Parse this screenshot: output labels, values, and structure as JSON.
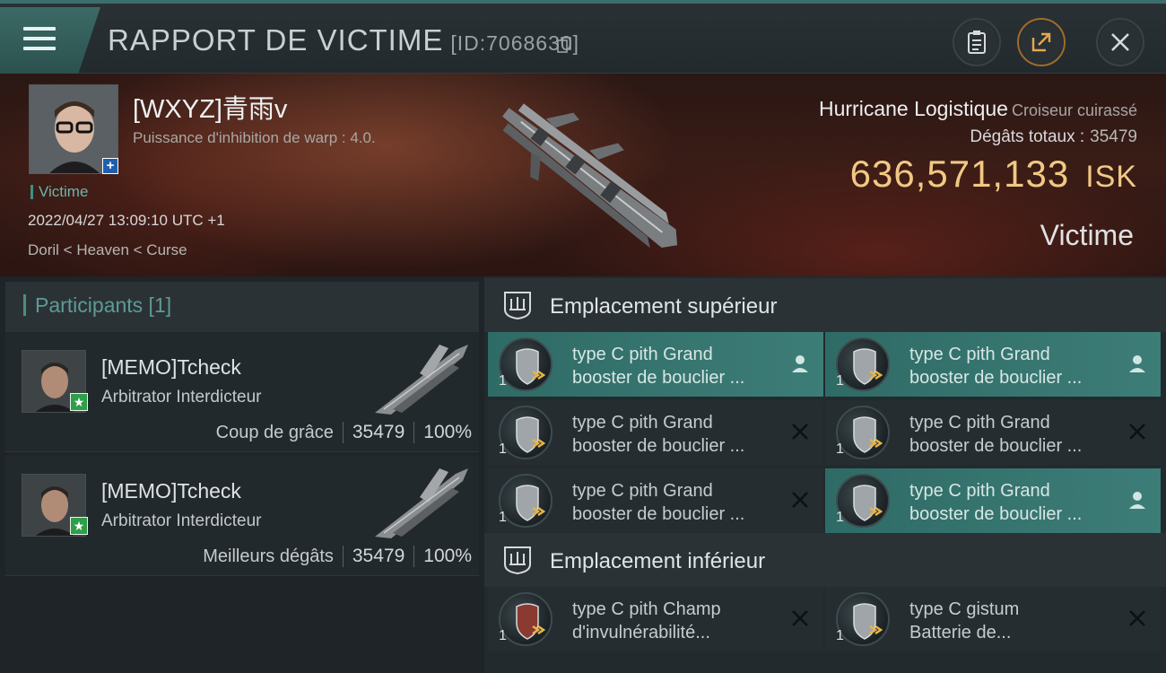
{
  "header": {
    "title": "RAPPORT DE VICTIME",
    "report_id": "[ID:7068630]"
  },
  "victim": {
    "name": "[WXYZ]青雨v",
    "subtitle": "Puissance d'inhibition de warp : 4.0.",
    "role_tag": "Victime",
    "datetime": "2022/04/27 13:09:10 UTC +1",
    "location": "Doril < Heaven < Curse",
    "ship_name": "Hurricane Logistique",
    "ship_class": "Croiseur cuirassé",
    "damage_label": "Dégâts totaux :",
    "damage_value": "35479",
    "isk_value": "636,571,133",
    "isk_unit": "ISK",
    "status_label": "Victime"
  },
  "participants": {
    "title": "Participants [1]",
    "rows": [
      {
        "name": "[MEMO]Tcheck",
        "ship": "Arbitrator Interdicteur",
        "label": "Coup de grâce",
        "damage": "35479",
        "percent": "100%"
      },
      {
        "name": "[MEMO]Tcheck",
        "ship": "Arbitrator Interdicteur",
        "label": "Meilleurs dégâts",
        "damage": "35479",
        "percent": "100%"
      }
    ]
  },
  "fittings": {
    "high_slots_title": "Emplacement supérieur",
    "low_slots_title": "Emplacement inférieur",
    "high_slots": [
      {
        "qty": "1",
        "line1": "type C pith Grand",
        "line2": "booster de bouclier ...",
        "status": "person-icon",
        "active": true
      },
      {
        "qty": "1",
        "line1": "type C pith Grand",
        "line2": "booster de bouclier ...",
        "status": "person-icon",
        "active": true
      },
      {
        "qty": "1",
        "line1": "type C pith Grand",
        "line2": "booster de bouclier ...",
        "status": "destroyed-x-icon",
        "active": false
      },
      {
        "qty": "1",
        "line1": "type C pith Grand",
        "line2": "booster de bouclier ...",
        "status": "destroyed-x-icon",
        "active": false
      },
      {
        "qty": "1",
        "line1": "type C pith Grand",
        "line2": "booster de bouclier ...",
        "status": "destroyed-x-icon",
        "active": false
      },
      {
        "qty": "1",
        "line1": "type C pith Grand",
        "line2": "booster de bouclier ...",
        "status": "person-icon",
        "active": true
      }
    ],
    "low_slots": [
      {
        "qty": "1",
        "line1": "type C pith Champ",
        "line2": "d'invulnérabilité...",
        "status": "destroyed-x-icon",
        "active": false
      },
      {
        "qty": "1",
        "line1": "type C gistum",
        "line2": "Batterie de...",
        "status": "destroyed-x-icon",
        "active": false
      }
    ]
  },
  "colors": {
    "accent_teal": "#3d7d77",
    "isk_gold": "#f1c983",
    "badge_blue": "#1f5fae",
    "badge_green": "#2f9e4a"
  }
}
